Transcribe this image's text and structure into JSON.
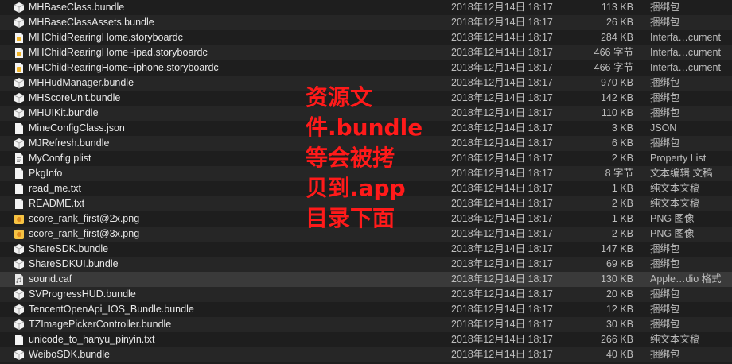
{
  "files": [
    {
      "name": "MHBaseClass.bundle",
      "date": "2018年12月14日 18:17",
      "size": "113 KB",
      "kind": "捆绑包",
      "icon": "bundle-icon"
    },
    {
      "name": "MHBaseClassAssets.bundle",
      "date": "2018年12月14日 18:17",
      "size": "26 KB",
      "kind": "捆绑包",
      "icon": "bundle-icon"
    },
    {
      "name": "MHChildRearingHome.storyboardc",
      "date": "2018年12月14日 18:17",
      "size": "284 KB",
      "kind": "Interfa…cument",
      "icon": "storyboard-icon"
    },
    {
      "name": "MHChildRearingHome~ipad.storyboardc",
      "date": "2018年12月14日 18:17",
      "size": "466 字节",
      "kind": "Interfa…cument",
      "icon": "storyboard-icon"
    },
    {
      "name": "MHChildRearingHome~iphone.storyboardc",
      "date": "2018年12月14日 18:17",
      "size": "466 字节",
      "kind": "Interfa…cument",
      "icon": "storyboard-icon"
    },
    {
      "name": "MHHudManager.bundle",
      "date": "2018年12月14日 18:17",
      "size": "970 KB",
      "kind": "捆绑包",
      "icon": "bundle-icon"
    },
    {
      "name": "MHScoreUnit.bundle",
      "date": "2018年12月14日 18:17",
      "size": "142 KB",
      "kind": "捆绑包",
      "icon": "bundle-icon"
    },
    {
      "name": "MHUIKit.bundle",
      "date": "2018年12月14日 18:17",
      "size": "110 KB",
      "kind": "捆绑包",
      "icon": "bundle-icon"
    },
    {
      "name": "MineConfigClass.json",
      "date": "2018年12月14日 18:17",
      "size": "3 KB",
      "kind": "JSON",
      "icon": "document-icon"
    },
    {
      "name": "MJRefresh.bundle",
      "date": "2018年12月14日 18:17",
      "size": "6 KB",
      "kind": "捆绑包",
      "icon": "bundle-icon"
    },
    {
      "name": "MyConfig.plist",
      "date": "2018年12月14日 18:17",
      "size": "2 KB",
      "kind": "Property List",
      "icon": "plist-icon"
    },
    {
      "name": "PkgInfo",
      "date": "2018年12月14日 18:17",
      "size": "8 字节",
      "kind": "文本编辑 文稿",
      "icon": "document-icon"
    },
    {
      "name": "read_me.txt",
      "date": "2018年12月14日 18:17",
      "size": "1 KB",
      "kind": "纯文本文稿",
      "icon": "document-icon"
    },
    {
      "name": "README.txt",
      "date": "2018年12月14日 18:17",
      "size": "2 KB",
      "kind": "纯文本文稿",
      "icon": "document-icon"
    },
    {
      "name": "score_rank_first@2x.png",
      "date": "2018年12月14日 18:17",
      "size": "1 KB",
      "kind": "PNG 图像",
      "icon": "image-icon"
    },
    {
      "name": "score_rank_first@3x.png",
      "date": "2018年12月14日 18:17",
      "size": "2 KB",
      "kind": "PNG 图像",
      "icon": "image-icon"
    },
    {
      "name": "ShareSDK.bundle",
      "date": "2018年12月14日 18:17",
      "size": "147 KB",
      "kind": "捆绑包",
      "icon": "bundle-icon"
    },
    {
      "name": "ShareSDKUI.bundle",
      "date": "2018年12月14日 18:17",
      "size": "69 KB",
      "kind": "捆绑包",
      "icon": "bundle-icon"
    },
    {
      "name": "sound.caf",
      "date": "2018年12月14日 18:17",
      "size": "130 KB",
      "kind": "Apple…dio 格式",
      "icon": "audio-icon"
    },
    {
      "name": "SVProgressHUD.bundle",
      "date": "2018年12月14日 18:17",
      "size": "20 KB",
      "kind": "捆绑包",
      "icon": "bundle-icon"
    },
    {
      "name": "TencentOpenApi_IOS_Bundle.bundle",
      "date": "2018年12月14日 18:17",
      "size": "12 KB",
      "kind": "捆绑包",
      "icon": "bundle-icon"
    },
    {
      "name": "TZImagePickerController.bundle",
      "date": "2018年12月14日 18:17",
      "size": "30 KB",
      "kind": "捆绑包",
      "icon": "bundle-icon"
    },
    {
      "name": "unicode_to_hanyu_pinyin.txt",
      "date": "2018年12月14日 18:17",
      "size": "266 KB",
      "kind": "纯文本文稿",
      "icon": "document-icon"
    },
    {
      "name": "WeiboSDK.bundle",
      "date": "2018年12月14日 18:17",
      "size": "40 KB",
      "kind": "捆绑包",
      "icon": "bundle-icon"
    }
  ],
  "selected_index": 18,
  "annotation": {
    "lines": [
      "资源文",
      "件.bundle",
      "等会被拷",
      "贝到.app",
      "目录下面"
    ],
    "color": "#ff1a1a"
  },
  "colors": {
    "background": "#1e1e1e",
    "row_alt": "#262626",
    "selected_row": "#3a3a3a",
    "text": "#e8e8e8",
    "secondary_text": "#bdbdbd"
  }
}
